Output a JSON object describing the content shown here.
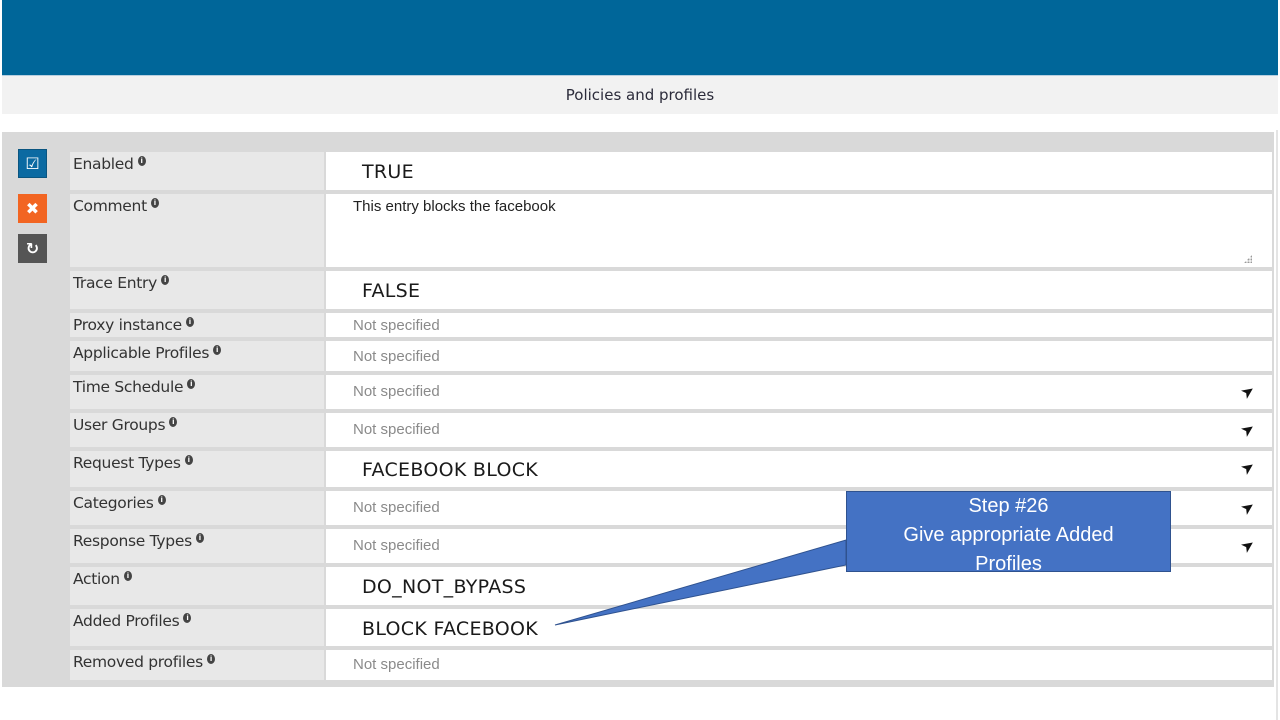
{
  "header": {
    "title": "Policies and profiles"
  },
  "side_buttons": {
    "save": {
      "icon": "checkbox-icon",
      "glyph": "☑"
    },
    "cancel": {
      "icon": "close-icon",
      "glyph": "✖"
    },
    "reset": {
      "icon": "undo-icon",
      "glyph": "↻"
    }
  },
  "info_glyph": "i",
  "plane_glyph": "➤",
  "fields": [
    {
      "label": "Enabled",
      "value": "TRUE"
    },
    {
      "label": "Comment",
      "value": "This entry blocks the facebook"
    },
    {
      "label": "Trace Entry",
      "value": "FALSE"
    },
    {
      "label": "Proxy instance",
      "value": "Not specified"
    },
    {
      "label": "Applicable Profiles",
      "value": "Not specified"
    },
    {
      "label": "Time Schedule",
      "value": "Not specified"
    },
    {
      "label": "User Groups",
      "value": "Not specified"
    },
    {
      "label": "Request Types",
      "value": "FACEBOOK BLOCK"
    },
    {
      "label": "Categories",
      "value": "Not specified"
    },
    {
      "label": "Response Types",
      "value": "Not specified"
    },
    {
      "label": "Action",
      "value": "DO_NOT_BYPASS"
    },
    {
      "label": "Added Profiles",
      "value": "BLOCK FACEBOOK"
    },
    {
      "label": "Removed profiles",
      "value": "Not specified"
    }
  ],
  "callout": {
    "line1": "Step #26",
    "line2": "Give appropriate Added",
    "line3": "Profiles",
    "color": "#4472c4"
  },
  "colors": {
    "topbar": "#006699",
    "save": "#0b6aa2",
    "cancel": "#f26522",
    "reset": "#555555"
  }
}
